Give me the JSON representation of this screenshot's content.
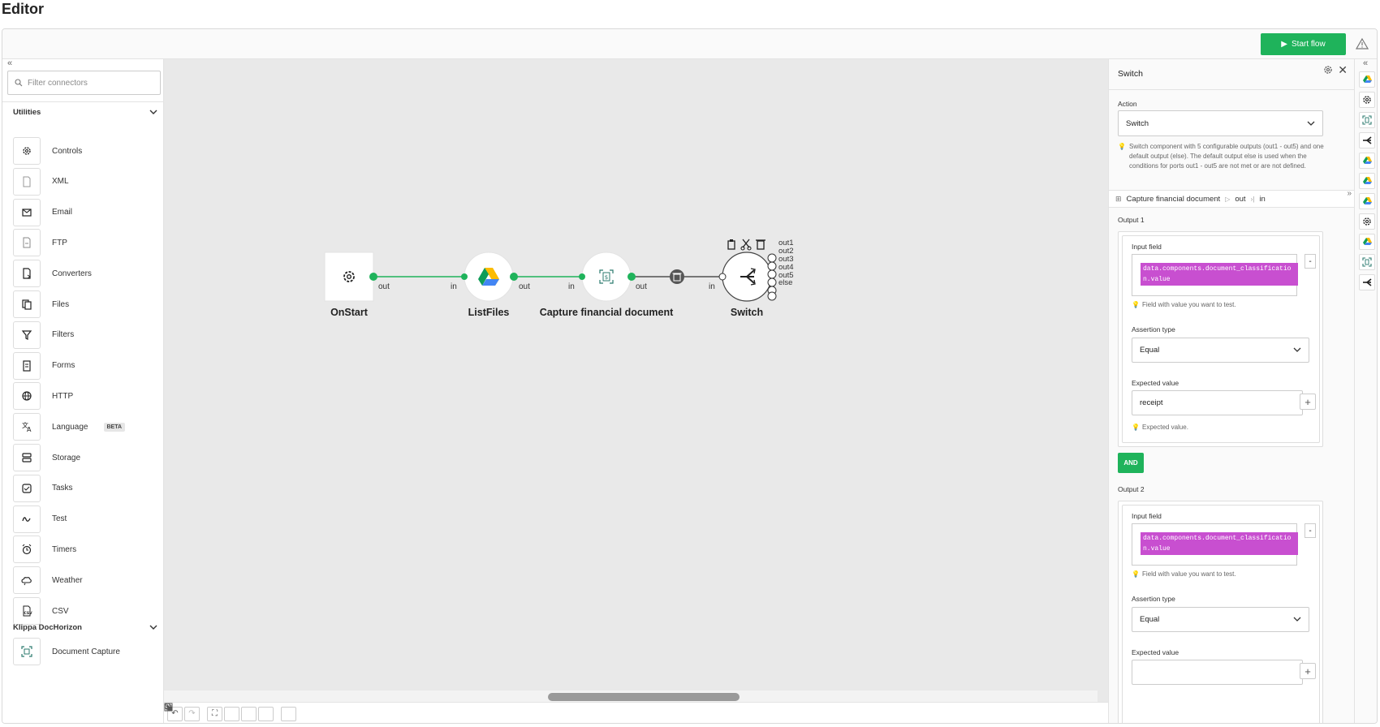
{
  "page": {
    "title": "Editor"
  },
  "toolbar": {
    "start_label": "Start flow"
  },
  "left": {
    "filter_placeholder": "Filter connectors",
    "groups": [
      {
        "label": "Utilities"
      },
      {
        "label": "Klippa DocHorizon"
      }
    ],
    "utilities": [
      {
        "label": "Controls",
        "icon": "controls-icon"
      },
      {
        "label": "XML",
        "icon": "xml-icon"
      },
      {
        "label": "Email",
        "icon": "email-icon"
      },
      {
        "label": "FTP",
        "icon": "ftp-icon"
      },
      {
        "label": "Converters",
        "icon": "converters-icon"
      },
      {
        "label": "Files",
        "icon": "files-icon"
      },
      {
        "label": "Filters",
        "icon": "filter-icon"
      },
      {
        "label": "Forms",
        "icon": "forms-icon"
      },
      {
        "label": "HTTP",
        "icon": "globe-icon"
      },
      {
        "label": "Language",
        "icon": "language-icon",
        "badge": "BETA"
      },
      {
        "label": "Storage",
        "icon": "storage-icon"
      },
      {
        "label": "Tasks",
        "icon": "tasks-icon"
      },
      {
        "label": "Test",
        "icon": "test-icon"
      },
      {
        "label": "Timers",
        "icon": "alarm-icon"
      },
      {
        "label": "Weather",
        "icon": "weather-icon"
      },
      {
        "label": "CSV",
        "icon": "csv-icon"
      }
    ],
    "dochorizon": [
      {
        "label": "Document Capture",
        "icon": "document-capture-icon"
      }
    ]
  },
  "canvas": {
    "nodes": [
      {
        "label": "OnStart"
      },
      {
        "label": "ListFiles"
      },
      {
        "label": "Capture financial document"
      },
      {
        "label": "Switch"
      }
    ],
    "ports": {
      "out": "out",
      "in": "in"
    },
    "switch_outputs": [
      "out1",
      "out2",
      "out3",
      "out4",
      "out5",
      "else"
    ]
  },
  "props": {
    "title": "Switch",
    "action_label": "Action",
    "action_value": "Switch",
    "description": "Switch component with 5 configurable outputs (out1 - out5) and one default output (else). The default output else is used when the conditions for ports out1 - out5 are not met or are not defined.",
    "breadcrumb": {
      "node": "Capture financial document",
      "out": "out",
      "in": "in"
    },
    "outputs": [
      {
        "title": "Output 1",
        "input_label": "Input field",
        "input_value": "data.components.document_classification.value",
        "input_hint": "Field with value you want to test.",
        "assertion_label": "Assertion type",
        "assertion_value": "Equal",
        "expected_label": "Expected value",
        "expected_value": "receipt",
        "expected_hint": "Expected value."
      },
      {
        "title": "Output 2",
        "input_label": "Input field",
        "input_value": "data.components.document_classification.value",
        "input_hint": "Field with value you want to test.",
        "assertion_label": "Assertion type",
        "assertion_value": "Equal",
        "expected_label": "Expected value"
      }
    ],
    "and_label": "AND"
  },
  "colors": {
    "accent": "#1fb35b",
    "tag": "#c84fd0",
    "hint_bulb": "#e0603e"
  }
}
